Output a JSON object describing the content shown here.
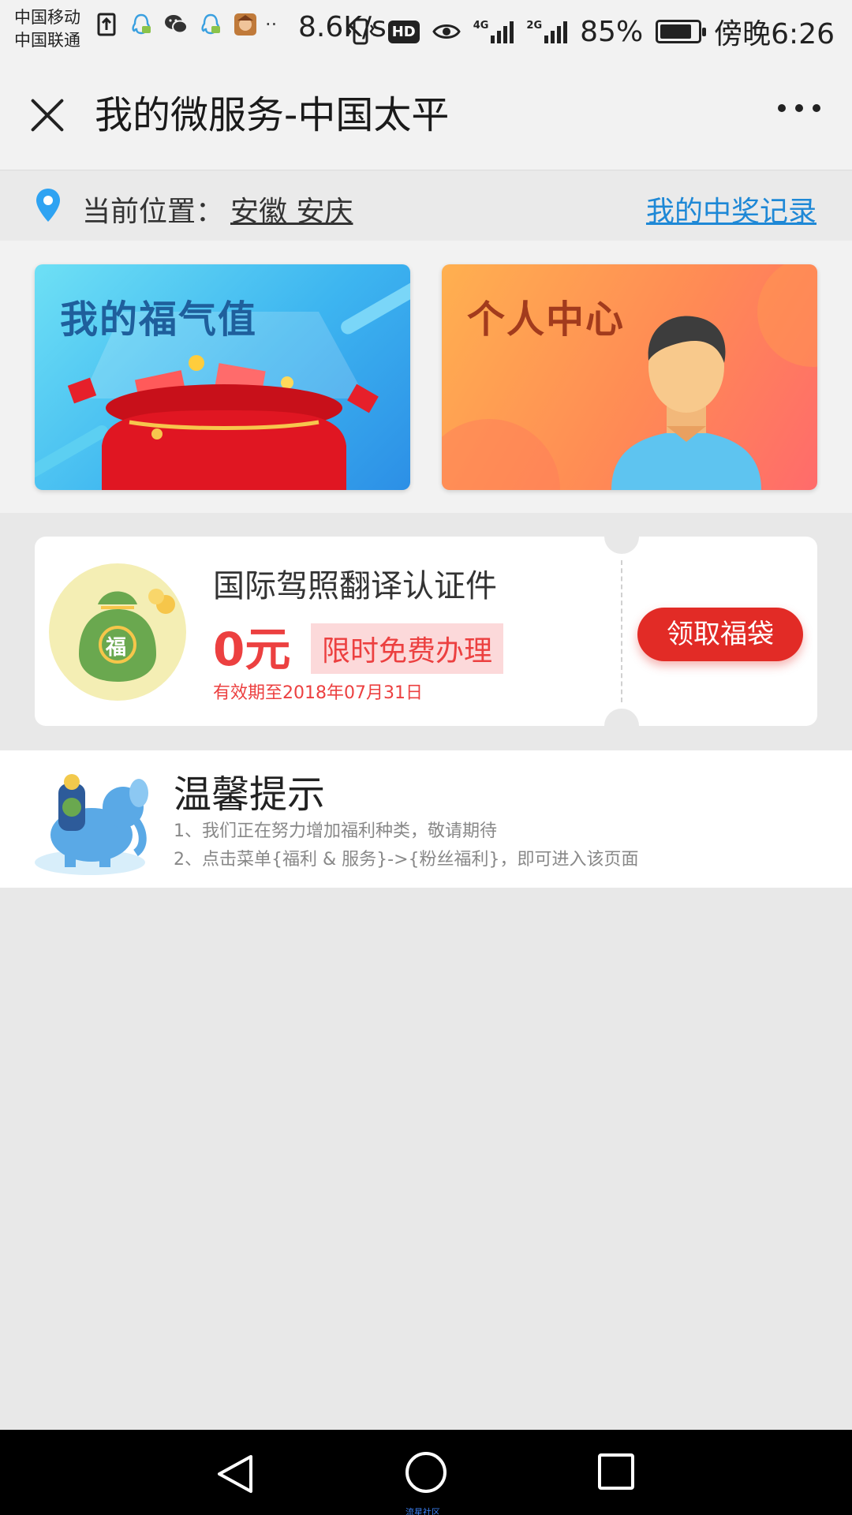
{
  "status_bar": {
    "carrier_1": "中国移动",
    "carrier_2": "中国联通",
    "net_speed": "8.6K/s",
    "network_4g": "4G",
    "network_2g": "2G",
    "battery": "85%",
    "battery_level": 0.85,
    "time": "傍晚6:26",
    "icons": [
      "upload-icon",
      "qq-icon",
      "wechat-icon",
      "qq-icon",
      "game-avatar-icon",
      "vibrate-icon",
      "hd-icon",
      "eye-icon"
    ]
  },
  "titlebar": {
    "title": "我的微服务-中国太平"
  },
  "location": {
    "label": "当前位置：",
    "value": "安徽 安庆",
    "prize_link": "我的中奖记录"
  },
  "banners": {
    "left_title": "我的福气值",
    "right_title": "个人中心"
  },
  "coupon": {
    "bag_char": "福",
    "title": "国际驾照翻译认证件",
    "price": "0元",
    "tag": "限时免费办理",
    "valid": "有效期至2018年07月31日",
    "button": "领取福袋"
  },
  "tips": {
    "title": "温馨提示",
    "line1": "1、我们正在努力增加福利种类，敬请期待",
    "line2": "2、点击菜单{福利 & 服务}->{粉丝福利}，即可进入该页面"
  },
  "navbar": {
    "watermark": "流星社区"
  },
  "colors": {
    "accent_red": "#e22b26",
    "link_blue": "#1e88d6"
  }
}
